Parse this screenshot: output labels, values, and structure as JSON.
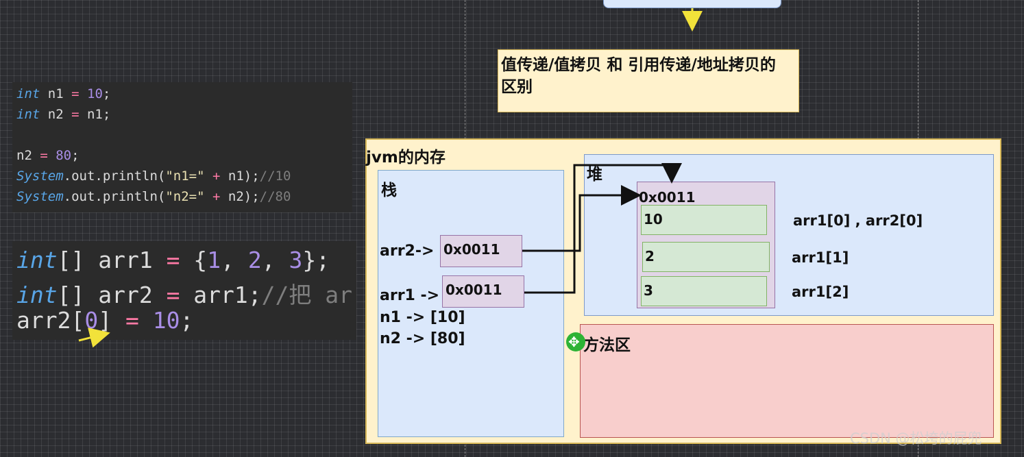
{
  "code_top": {
    "lines": [
      [
        {
          "t": "int",
          "c": "kw"
        },
        {
          "t": " n1 ",
          "c": "fn"
        },
        {
          "t": "=",
          "c": "op"
        },
        {
          "t": " ",
          "c": "fn"
        },
        {
          "t": "10",
          "c": "num"
        },
        {
          "t": ";",
          "c": "fn"
        }
      ],
      [
        {
          "t": "int",
          "c": "kw"
        },
        {
          "t": " n2 ",
          "c": "fn"
        },
        {
          "t": "=",
          "c": "op"
        },
        {
          "t": " n1;",
          "c": "fn"
        }
      ],
      [],
      [
        {
          "t": "n2 ",
          "c": "fn"
        },
        {
          "t": "=",
          "c": "op"
        },
        {
          "t": " ",
          "c": "fn"
        },
        {
          "t": "80",
          "c": "num"
        },
        {
          "t": ";",
          "c": "fn"
        }
      ],
      [
        {
          "t": "System",
          "c": "kw"
        },
        {
          "t": ".out.println(",
          "c": "fn"
        },
        {
          "t": "\"n1=\"",
          "c": "str"
        },
        {
          "t": " ",
          "c": "fn"
        },
        {
          "t": "+",
          "c": "op"
        },
        {
          "t": " n1);",
          "c": "fn"
        },
        {
          "t": "//10",
          "c": "cmt"
        }
      ],
      [
        {
          "t": "System",
          "c": "kw"
        },
        {
          "t": ".out.println(",
          "c": "fn"
        },
        {
          "t": "\"n2=\"",
          "c": "str"
        },
        {
          "t": " ",
          "c": "fn"
        },
        {
          "t": "+",
          "c": "op"
        },
        {
          "t": " n2);",
          "c": "fn"
        },
        {
          "t": "//80",
          "c": "cmt"
        }
      ]
    ]
  },
  "code_bottom": {
    "lines": [
      [
        {
          "t": "int",
          "c": "kw"
        },
        {
          "t": "[] arr1 ",
          "c": "fn"
        },
        {
          "t": "=",
          "c": "op"
        },
        {
          "t": " {",
          "c": "fn"
        },
        {
          "t": "1",
          "c": "num"
        },
        {
          "t": ", ",
          "c": "fn"
        },
        {
          "t": "2",
          "c": "num"
        },
        {
          "t": ", ",
          "c": "fn"
        },
        {
          "t": "3",
          "c": "num"
        },
        {
          "t": "};",
          "c": "fn"
        }
      ],
      [
        {
          "t": "int",
          "c": "kw"
        },
        {
          "t": "[] arr2 ",
          "c": "fn"
        },
        {
          "t": "=",
          "c": "op"
        },
        {
          "t": " arr1;",
          "c": "fn"
        },
        {
          "t": "//把 ar",
          "c": "cmt"
        }
      ],
      [
        {
          "t": "arr2[",
          "c": "fn"
        },
        {
          "t": "0",
          "c": "num"
        },
        {
          "t": "] ",
          "c": "fn"
        },
        {
          "t": "=",
          "c": "op"
        },
        {
          "t": " ",
          "c": "fn"
        },
        {
          "t": "10",
          "c": "num"
        },
        {
          "t": ";",
          "c": "fn"
        }
      ]
    ]
  },
  "note": "值传递/值拷贝 和  引用传递/地址拷贝的 区别",
  "jvm": {
    "title": "jvm的内存",
    "stack": {
      "title": "栈",
      "arr2_label": "arr2->",
      "arr2_addr": "0x0011",
      "arr1_label": "arr1 ->",
      "arr1_addr": "0x0011",
      "n1": "n1 -> [10]",
      "n2": "n2 -> [80]"
    },
    "heap": {
      "title": "堆",
      "obj_addr": "0x0011",
      "cells": [
        "10",
        "2",
        "3"
      ],
      "cell_labels": [
        "arr1[0] , arr2[0]",
        "arr1[1]",
        "arr1[2]"
      ]
    },
    "method_area": {
      "title": "方法区"
    }
  },
  "cursor_glyph": "✥",
  "watermark": "CSDN @松垮的屁兜",
  "colors": {
    "keyword": "#59a6e8",
    "number": "#a98ee6",
    "operator": "#ff7aa6",
    "string": "#e9e0b2",
    "comment": "#7e7e7e",
    "note_bg": "#fff2cc",
    "region_blue": "#dbe8fb",
    "method_pink": "#f8cecc",
    "addr_purple": "#e1d5e7",
    "cell_green": "#d5e8d4"
  }
}
